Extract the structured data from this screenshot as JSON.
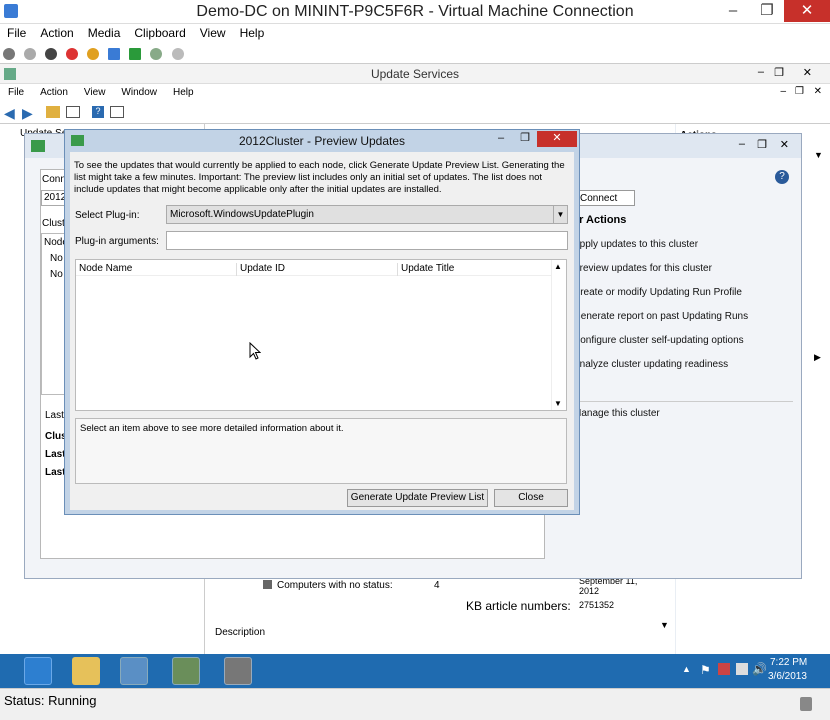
{
  "vm": {
    "title": "Demo-DC on MININT-P9C5F6R - Virtual Machine Connection",
    "menu": [
      "File",
      "Action",
      "Media",
      "Clipboard",
      "View",
      "Help"
    ],
    "status": "Status: Running"
  },
  "update_services": {
    "title": "Update Services",
    "menu": [
      "File",
      "Action",
      "View",
      "Window",
      "Help"
    ],
    "tree_item": "Update Se",
    "actions_header": "Actions",
    "bg_status_label": "Computers with no status:",
    "bg_status_value": "4",
    "bg_date": "September 11, 2012",
    "bg_kb_label": "KB article numbers:",
    "bg_kb_value": "2751352",
    "bg_description": "Description"
  },
  "cau": {
    "connect_label": "Conn",
    "connect_value": "2012",
    "connect_button": "Connect",
    "cluster_label": "Clust",
    "node_label": "Node",
    "node_rows": [
      "No",
      "No"
    ],
    "last_tab": "Last",
    "last_rows": [
      "Clus",
      "Last",
      "Last"
    ],
    "actions_header": "er Actions",
    "actions": [
      "Apply updates to this cluster",
      "Preview updates for this cluster",
      "Create or modify Updating Run Profile",
      "Generate report on past Updating Runs",
      "Configure cluster self-updating options",
      "Analyze cluster updating readiness",
      "Manage this cluster"
    ]
  },
  "dialog": {
    "title": "2012Cluster - Preview Updates",
    "description": "To see the updates that would currently be applied to each node, click Generate Update Preview List. Generating the list might take a few minutes. Important: The preview list includes only an initial set of updates. The list does not include updates that might become applicable only after the initial updates are installed.",
    "plugin_label": "Select Plug-in:",
    "plugin_value": "Microsoft.WindowsUpdatePlugin",
    "args_label": "Plug-in arguments:",
    "args_value": "",
    "columns": [
      "Node Name",
      "Update ID",
      "Update Title"
    ],
    "detail_text": "Select an item above to see more detailed information about it.",
    "generate_button": "Generate Update Preview List",
    "close_button": "Close"
  },
  "taskbar": {
    "time": "7:22 PM",
    "date": "3/6/2013"
  }
}
